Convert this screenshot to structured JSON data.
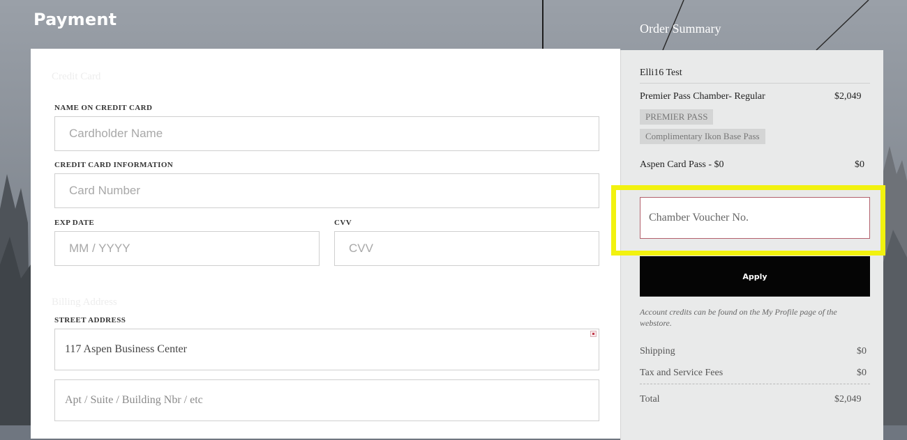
{
  "header": {
    "title": "Payment",
    "summary_title": "Order Summary"
  },
  "payment": {
    "credit_card_heading": "Credit Card",
    "name_label": "NAME ON CREDIT CARD",
    "name_placeholder": "Cardholder Name",
    "card_info_label": "CREDIT CARD INFORMATION",
    "card_number_placeholder": "Card Number",
    "exp_label": "EXP DATE",
    "exp_placeholder": "MM / YYYY",
    "cvv_label": "CVV",
    "cvv_placeholder": "CVV",
    "billing_heading": "Billing Address",
    "street_label": "STREET ADDRESS",
    "street_value": "117 Aspen Business Center",
    "apt_placeholder": "Apt / Suite / Building Nbr / etc"
  },
  "summary": {
    "customer": "Elli16 Test",
    "items": [
      {
        "name": "Premier Pass Chamber- Regular",
        "price": "$2,049",
        "tags": [
          "PREMIER PASS",
          "Complimentary Ikon Base Pass"
        ]
      },
      {
        "name": "Aspen Card Pass - $0",
        "price": "$0"
      }
    ],
    "voucher_placeholder": "Chamber Voucher No.",
    "apply_label": "Apply",
    "credit_note": "Account credits can be found on the My Profile page of the webstore.",
    "shipping_label": "Shipping",
    "shipping_value": "$0",
    "tax_label": "Tax and Service Fees",
    "tax_value": "$0",
    "total_label": "Total",
    "total_value": "$2,049"
  },
  "colors": {
    "highlight": "#f2f20f",
    "apply_button": "#050505",
    "voucher_border": "#b2606c"
  }
}
